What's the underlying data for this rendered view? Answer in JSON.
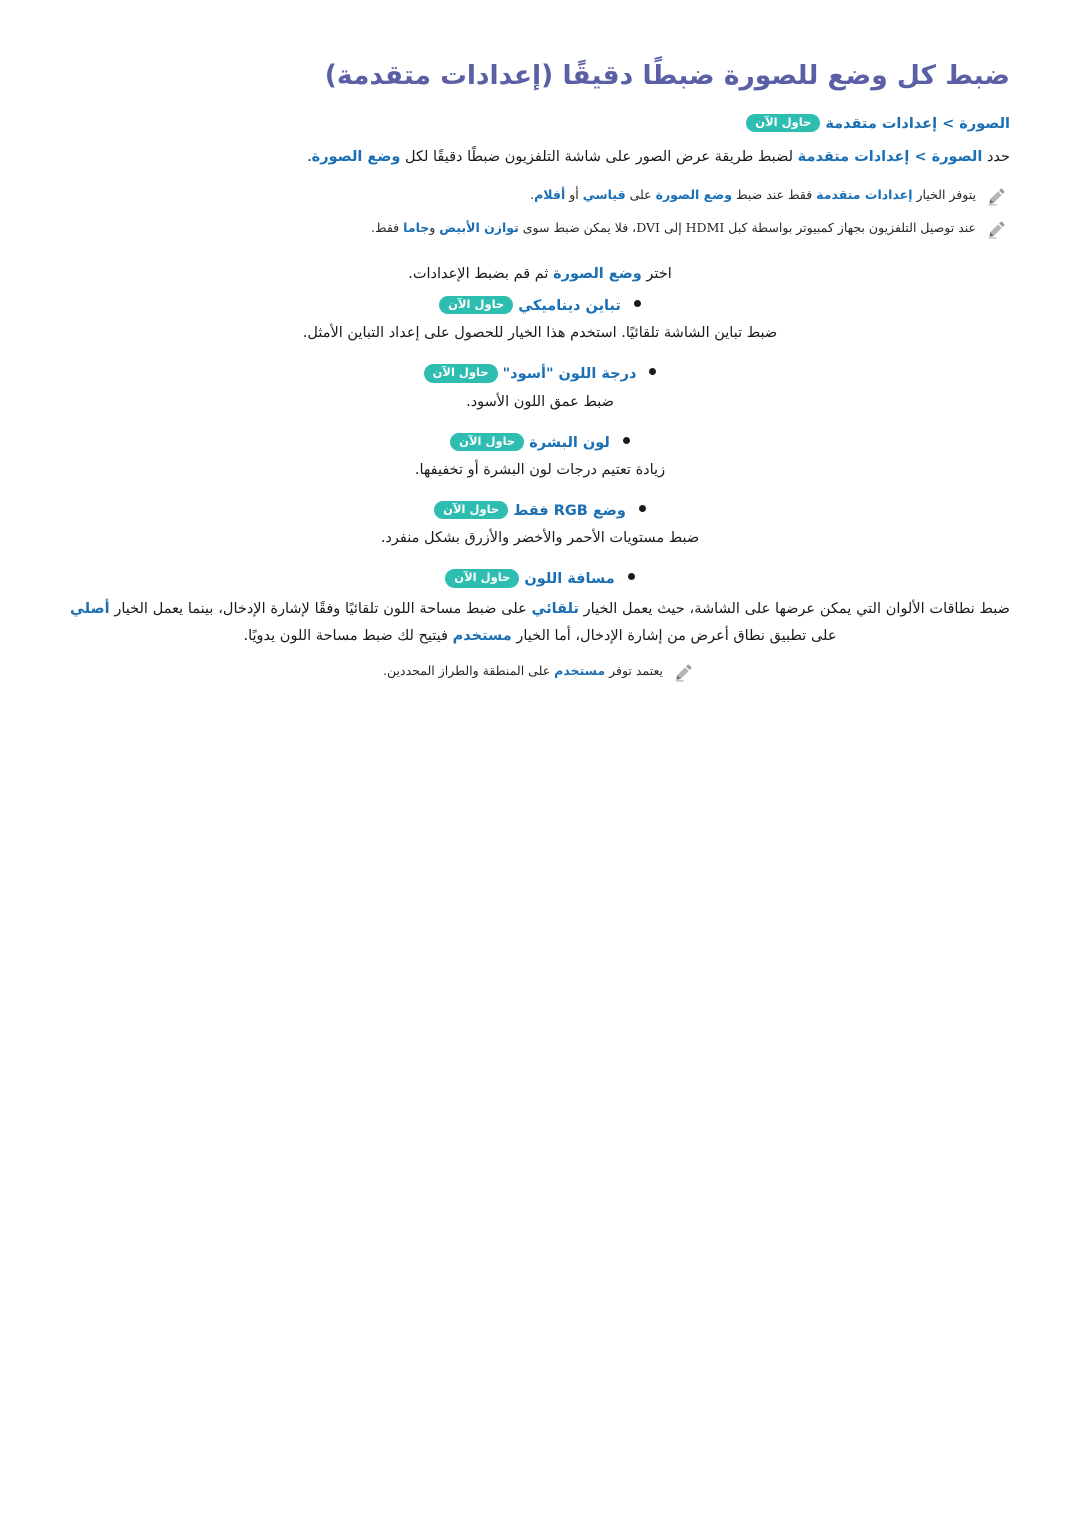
{
  "title": "ضبط كل وضع للصورة ضبطًا دقيقًا (إعدادات متقدمة)",
  "badge_label": "حاول الآن",
  "breadcrumb": {
    "text": "الصورة > إعدادات متقدمة",
    "badge": "حاول الآن"
  },
  "intro": {
    "prefix": "حدد ",
    "link1": "الصورة > إعدادات متقدمة",
    "middle": " لضبط طريقة عرض الصور على شاشة التلفزيون ضبطًا دقيقًا لكل ",
    "link2": "وضع الصورة",
    "suffix": "."
  },
  "notes_top": [
    {
      "icon": "pencil-icon",
      "segments": [
        {
          "text": "يتوفر الخيار ",
          "style": "normal"
        },
        {
          "text": "إعدادات متقدمة",
          "style": "link"
        },
        {
          "text": " فقط عند ضبط ",
          "style": "normal"
        },
        {
          "text": "وضع الصورة",
          "style": "link"
        },
        {
          "text": " على ",
          "style": "normal"
        },
        {
          "text": "قياسي",
          "style": "link"
        },
        {
          "text": " أو ",
          "style": "normal"
        },
        {
          "text": "أفلام",
          "style": "link"
        },
        {
          "text": ".",
          "style": "normal"
        }
      ]
    },
    {
      "icon": "pencil-icon",
      "segments": [
        {
          "text": "عند توصيل التلفزيون بجهاز كمبيوتر بواسطة كبل HDMI إلى DVI، فلا يمكن ضبط سوى ",
          "style": "normal"
        },
        {
          "text": "توازن الأبيض",
          "style": "link"
        },
        {
          "text": " و",
          "style": "normal"
        },
        {
          "text": "جاما",
          "style": "link"
        },
        {
          "text": " فقط.",
          "style": "normal"
        }
      ]
    }
  ],
  "select_line": {
    "prefix": "اختر ",
    "link": "وضع الصورة",
    "suffix": " ثم قم بضبط الإعدادات."
  },
  "bullets": [
    {
      "term": "تباين ديناميكي",
      "badge": "حاول الآن",
      "desc": "ضبط تباين الشاشة تلقائيًا. استخدم هذا الخيار للحصول على إعداد التباين الأمثل."
    },
    {
      "term": "درجة اللون \"أسود\"",
      "badge": "حاول الآن",
      "desc": "ضبط عمق اللون الأسود."
    },
    {
      "term": "لون البشرة",
      "badge": "حاول الآن",
      "desc": "زيادة تعتيم درجات لون البشرة أو تخفيفها."
    },
    {
      "term": "وضع RGB فقط",
      "badge": "حاول الآن",
      "desc": "ضبط مستويات الأحمر والأخضر والأزرق بشكل منفرد."
    },
    {
      "term": "مسافة اللون",
      "badge": "حاول الآن",
      "desc": ""
    }
  ],
  "color_space_paragraph": {
    "segments": [
      {
        "text": "ضبط نطاقات الألوان التي يمكن عرضها على الشاشة، حيث يعمل الخيار ",
        "style": "normal"
      },
      {
        "text": "تلقائي",
        "style": "link"
      },
      {
        "text": " على ضبط مساحة اللون تلقائيًا وفقًا لإشارة الإدخال، بينما يعمل الخيار ",
        "style": "normal"
      },
      {
        "text": "أصلي",
        "style": "link"
      },
      {
        "text": " على تطبيق نطاق أعرض من إشارة الإدخال، أما الخيار ",
        "style": "normal"
      },
      {
        "text": "مستخدم",
        "style": "link"
      },
      {
        "text": " فيتيح لك ضبط مساحة اللون يدويًا.",
        "style": "normal"
      }
    ]
  },
  "note_footer": {
    "icon": "pencil-icon",
    "segments": [
      {
        "text": "يعتمد توفر ",
        "style": "normal"
      },
      {
        "text": "مستخدم",
        "style": "link"
      },
      {
        "text": " على المنطقة والطراز المحددين.",
        "style": "normal"
      }
    ]
  },
  "colors": {
    "title": "#5a5fa6",
    "link": "#1a6fb5",
    "badge_bg": "#2ebdb1",
    "badge_text": "#ffffff",
    "body_text": "#1a1a1a",
    "note_text": "#262626",
    "pencil": "#8c8c8c",
    "page_bg": "#ffffff"
  }
}
